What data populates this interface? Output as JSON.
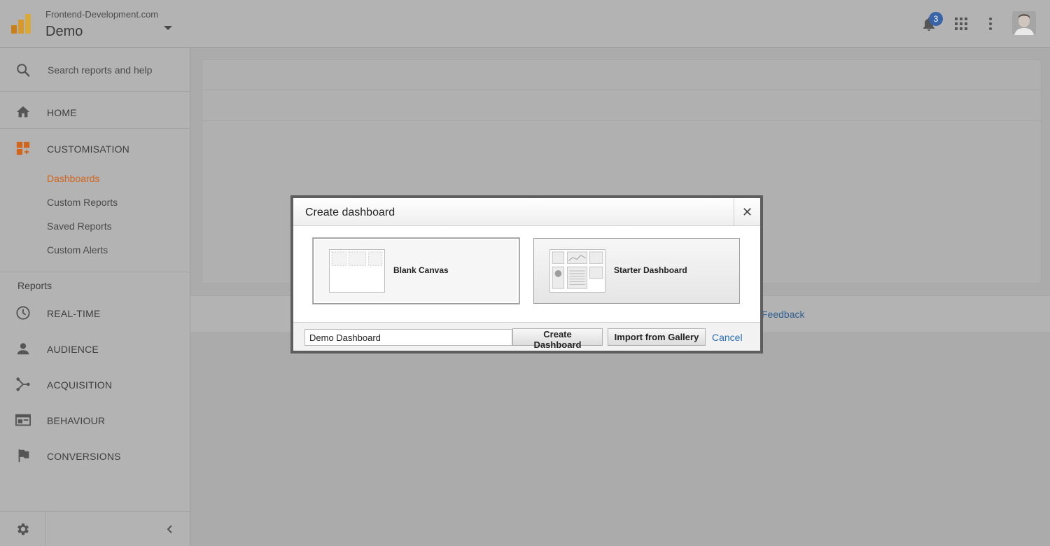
{
  "header": {
    "account_domain": "Frontend-Development.com",
    "account_name": "Demo",
    "notification_count": "3"
  },
  "sidebar": {
    "search_placeholder": "Search reports and help",
    "home": "HOME",
    "customisation": "CUSTOMISATION",
    "customisation_items": [
      "Dashboards",
      "Custom Reports",
      "Saved Reports",
      "Custom Alerts"
    ],
    "reports_heading": "Reports",
    "report_items": [
      "REAL-TIME",
      "AUDIENCE",
      "ACQUISITION",
      "BEHAVIOUR",
      "CONVERSIONS"
    ]
  },
  "content": {
    "feedback_link": "Feedback"
  },
  "dialog": {
    "title": "Create dashboard",
    "close_glyph": "✕",
    "options": [
      {
        "label": "Blank Canvas",
        "selected": true
      },
      {
        "label": "Starter Dashboard",
        "selected": false
      }
    ],
    "name_value": "Demo Dashboard",
    "create_button": "Create Dashboard",
    "import_button": "Import from Gallery",
    "cancel_link": "Cancel"
  },
  "colors": {
    "accent_orange": "#d0651e",
    "link_blue": "#2a6db8",
    "badge_blue": "#3a64a8"
  },
  "icons": [
    "analytics-logo-icon",
    "chevron-down-icon",
    "bell-icon",
    "apps-grid-icon",
    "more-vert-icon",
    "search-icon",
    "home-icon",
    "dashboard-add-icon",
    "clock-icon",
    "person-icon",
    "acquisition-icon",
    "behaviour-icon",
    "flag-icon",
    "gear-icon",
    "chevron-left-icon",
    "close-icon"
  ]
}
